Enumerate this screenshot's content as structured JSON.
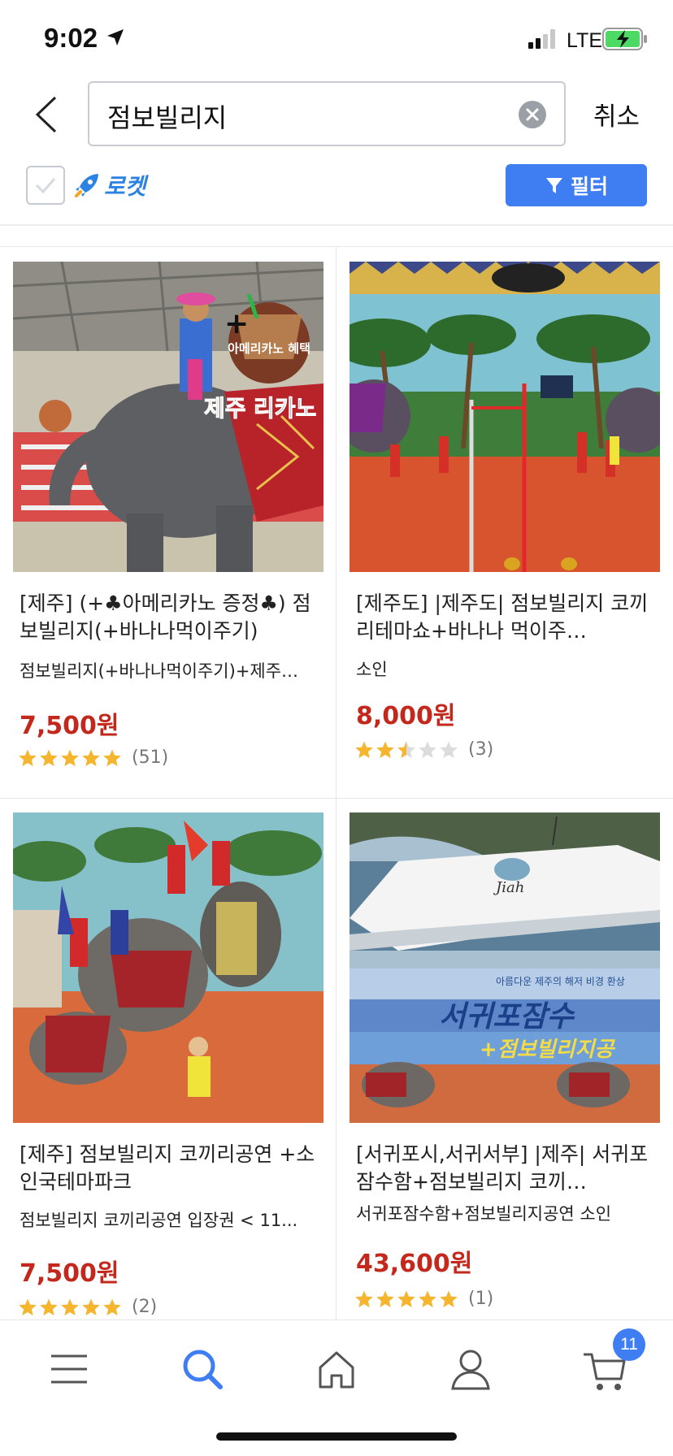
{
  "status_bar": {
    "time": "9:02",
    "carrier": "LTE"
  },
  "search": {
    "query": "점보빌리지",
    "cancel_label": "취소"
  },
  "filters": {
    "rocket_label": "로켓",
    "filter_label": "필터"
  },
  "colors": {
    "accent": "#3f7df2",
    "price": "#c4281c",
    "star": "#f5b52f",
    "star_empty": "#dcdcdc"
  },
  "products": [
    {
      "title": "[제주] (+♣아메리카노 증정♣) 점보빌리지(+바나나먹이주기)",
      "subtitle": "점보빌리지(+바나나먹이주기)+제주…",
      "price": "7,500원",
      "rating": 5,
      "review_count": "(51)",
      "image_overlay": {
        "badge_text": "아메리카노 혜택",
        "brand_a": "제주",
        "brand_b": "리카노"
      }
    },
    {
      "title": "[제주도] |제주도| 점보빌리지 코끼리테마쇼+바나나 먹이주…",
      "subtitle": "소인",
      "price": "8,000원",
      "rating": 2.5,
      "review_count": "(3)"
    },
    {
      "title": "[제주] 점보빌리지 코끼리공연 +소인국테마파크",
      "subtitle": "점보빌리지 코끼리공연 입장권 < 11...",
      "price": "7,500원",
      "rating": 5,
      "review_count": "(2)"
    },
    {
      "title": "[서귀포시,서귀서부] |제주| 서귀포잠수함+점보빌리지 코끼…",
      "subtitle": "서귀포잠수함+점보빌리지공연 소인",
      "price": "43,600원",
      "rating": 5,
      "review_count": "(1)",
      "image_overlay": {
        "tagline": "아름다운 제주의 해저 비경 환상",
        "headline": "서귀포잠수",
        "subline": "+점보빌리지공",
        "boat_name": "Jiah"
      }
    }
  ],
  "nav": {
    "cart_count": "11"
  }
}
